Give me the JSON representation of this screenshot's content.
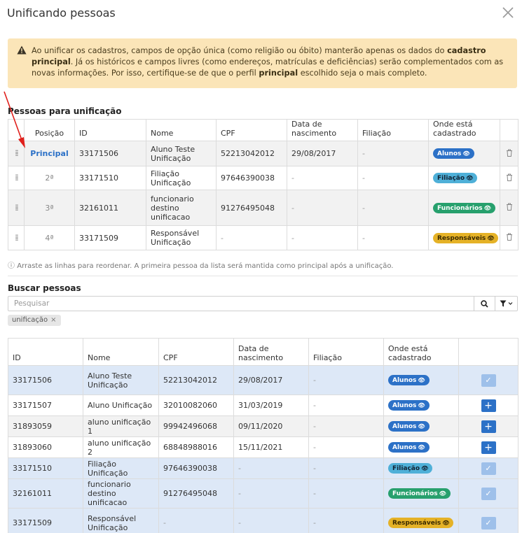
{
  "modal": {
    "title": "Unificando pessoas"
  },
  "alert": {
    "text_1": "Ao unificar os cadastros, campos de opção única (como religião ou óbito) manterão apenas os dados do ",
    "bold_1": "cadastro principal",
    "text_2": ". Já os históricos e campos livres (como endereços, matrículas e deficiências) serão complementados com as novas informações. Por isso, certifique-se de que o perfil ",
    "bold_2": "principal",
    "text_3": " escolhido seja o mais completo."
  },
  "merge_section": {
    "title": "Pessoas para unificação",
    "headers": {
      "posicao": "Posição",
      "id": "ID",
      "nome": "Nome",
      "cpf": "CPF",
      "nascimento": "Data de nascimento",
      "filiacao": "Filiação",
      "onde": "Onde está cadastrado"
    },
    "rows": [
      {
        "pos": "Principal",
        "id": "33171506",
        "nome": "Aluno Teste Unificação",
        "cpf": "52213042012",
        "nasc": "29/08/2017",
        "filiacao": "-",
        "badge": "Alunos"
      },
      {
        "pos": "2ª",
        "id": "33171510",
        "nome": "Filiação Unificação",
        "cpf": "97646390038",
        "nasc": "-",
        "filiacao": "-",
        "badge": "Filiação"
      },
      {
        "pos": "3ª",
        "id": "32161011",
        "nome": "funcionario destino unificacao",
        "cpf": "91276495048",
        "nasc": "-",
        "filiacao": "-",
        "badge": "Funcionários"
      },
      {
        "pos": "4ª",
        "id": "33171509",
        "nome": "Responsável Unificação",
        "cpf": "-",
        "nasc": "-",
        "filiacao": "-",
        "badge": "Responsáveis"
      }
    ],
    "hint": "Arraste as linhas para reordenar. A primeira pessoa da lista será mantida como principal após a unificação."
  },
  "search_section": {
    "title": "Buscar pessoas",
    "placeholder": "Pesquisar",
    "chip": "unificação",
    "headers": {
      "id": "ID",
      "nome": "Nome",
      "cpf": "CPF",
      "nascimento": "Data de nascimento",
      "filiacao": "Filiação",
      "onde": "Onde está cadastrado"
    },
    "rows": [
      {
        "id": "33171506",
        "nome": "Aluno Teste Unificação",
        "cpf": "52213042012",
        "nasc": "29/08/2017",
        "filiacao": "-",
        "badge": "Alunos",
        "added": true
      },
      {
        "id": "33171507",
        "nome": "Aluno Unificação",
        "cpf": "32010082060",
        "nasc": "31/03/2019",
        "filiacao": "-",
        "badge": "Alunos",
        "added": false
      },
      {
        "id": "31893059",
        "nome": "aluno unificação 1",
        "cpf": "99942496068",
        "nasc": "09/11/2020",
        "filiacao": "-",
        "badge": "Alunos",
        "added": false
      },
      {
        "id": "31893060",
        "nome": "aluno unificação 2",
        "cpf": "68848988016",
        "nasc": "15/11/2021",
        "filiacao": "-",
        "badge": "Alunos",
        "added": false
      },
      {
        "id": "33171510",
        "nome": "Filiação Unificação",
        "cpf": "97646390038",
        "nasc": "-",
        "filiacao": "-",
        "badge": "Filiação",
        "added": true
      },
      {
        "id": "32161011",
        "nome": "funcionario destino unificacao",
        "cpf": "91276495048",
        "nasc": "-",
        "filiacao": "-",
        "badge": "Funcionários",
        "added": true
      },
      {
        "id": "33171509",
        "nome": "Responsável Unificação",
        "cpf": "-",
        "nasc": "-",
        "filiacao": "-",
        "badge": "Responsáveis",
        "added": true
      }
    ]
  },
  "colors": {
    "alunos": "#2c71c7",
    "filiacao": "#4fb0d8",
    "funcionarios": "#27a06d",
    "responsaveis": "#e5b227",
    "alert_bg": "#fbe5b8",
    "selected_row": "#dde8f7",
    "annotation_arrow": "#e0201c"
  },
  "icons": {
    "close": "close-icon",
    "warning": "warning-triangle-icon",
    "drag": "drag-handle-icon",
    "eye": "eye-icon",
    "trash": "trash-icon",
    "search": "search-icon",
    "filter": "filter-icon",
    "add": "plus-icon",
    "added": "check-icon",
    "info": "info-icon"
  }
}
